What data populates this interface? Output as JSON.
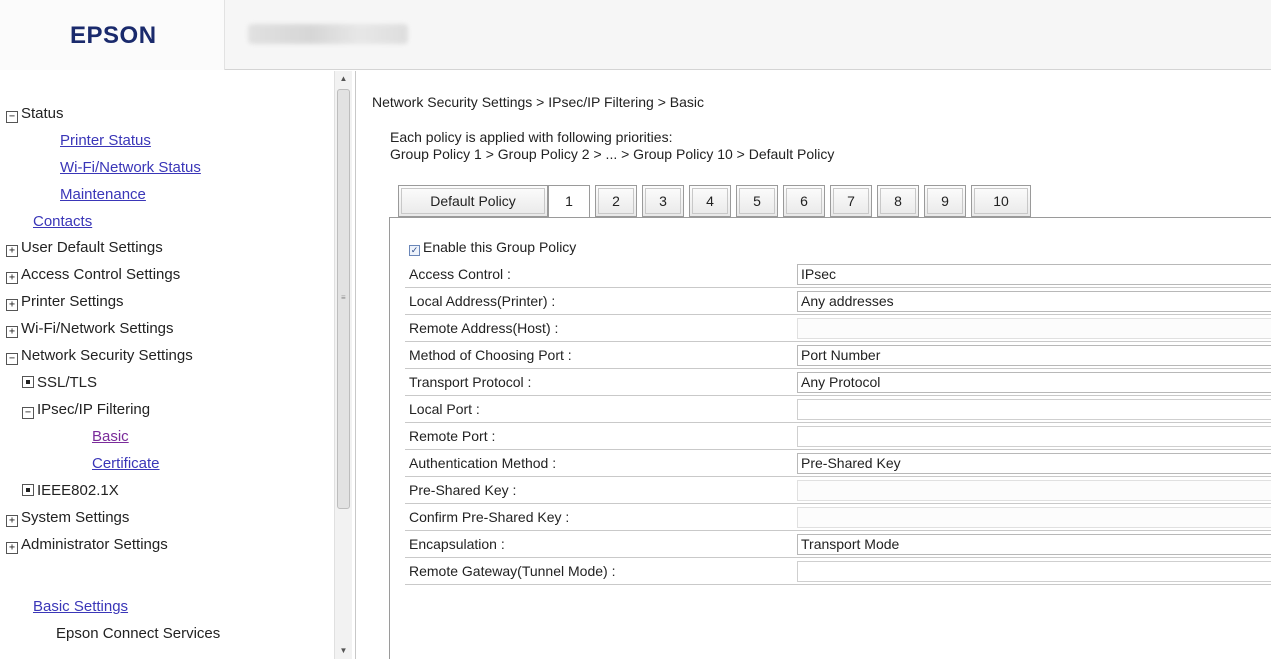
{
  "header": {
    "logo": "EPSON"
  },
  "sidebar": {
    "status": "Status",
    "printer_status": "Printer Status",
    "wifi_network_status": "Wi-Fi/Network Status",
    "maintenance": "Maintenance",
    "contacts": "Contacts",
    "user_default_settings": "User Default Settings",
    "access_control_settings": "Access Control Settings",
    "printer_settings": "Printer Settings",
    "wifi_network_settings": "Wi-Fi/Network Settings",
    "network_security_settings": "Network Security Settings",
    "ssl_tls": "SSL/TLS",
    "ipsec_ip_filtering": "IPsec/IP Filtering",
    "basic": "Basic",
    "certificate": "Certificate",
    "ieee8021x": "IEEE802.1X",
    "system_settings": "System Settings",
    "administrator_settings": "Administrator Settings",
    "basic_settings": "Basic Settings",
    "epson_connect_services": "Epson Connect Services",
    "expand_symbol": "+",
    "collapse_symbol": "−"
  },
  "main": {
    "breadcrumb": "Network Security Settings > IPsec/IP Filtering > Basic",
    "note_line1": "Each policy is applied with following priorities:",
    "note_line2": "Group Policy 1 > Group Policy 2 > ... > Group Policy 10 > Default Policy",
    "tabs": [
      "Default Policy",
      "1",
      "2",
      "3",
      "4",
      "5",
      "6",
      "7",
      "8",
      "9",
      "10"
    ],
    "active_tab": "1",
    "enable_label": "Enable this Group Policy",
    "enable_checked": true,
    "fields": {
      "access_control": {
        "label": "Access Control :",
        "value": "IPsec"
      },
      "local_address": {
        "label": "Local Address(Printer) :",
        "value": "Any addresses"
      },
      "remote_address": {
        "label": "Remote Address(Host) :",
        "value": ""
      },
      "method_port": {
        "label": "Method of Choosing Port :",
        "value": "Port Number"
      },
      "transport_protocol": {
        "label": "Transport Protocol :",
        "value": "Any Protocol"
      },
      "local_port": {
        "label": "Local Port :",
        "value": ""
      },
      "remote_port": {
        "label": "Remote Port :",
        "value": ""
      },
      "auth_method": {
        "label": "Authentication Method :",
        "value": "Pre-Shared Key"
      },
      "psk": {
        "label": "Pre-Shared Key :",
        "value": ""
      },
      "confirm_psk": {
        "label": "Confirm Pre-Shared Key :",
        "value": ""
      },
      "encapsulation": {
        "label": "Encapsulation :",
        "value": "Transport Mode"
      },
      "remote_gateway": {
        "label": "Remote Gateway(Tunnel Mode) :",
        "value": ""
      }
    }
  }
}
